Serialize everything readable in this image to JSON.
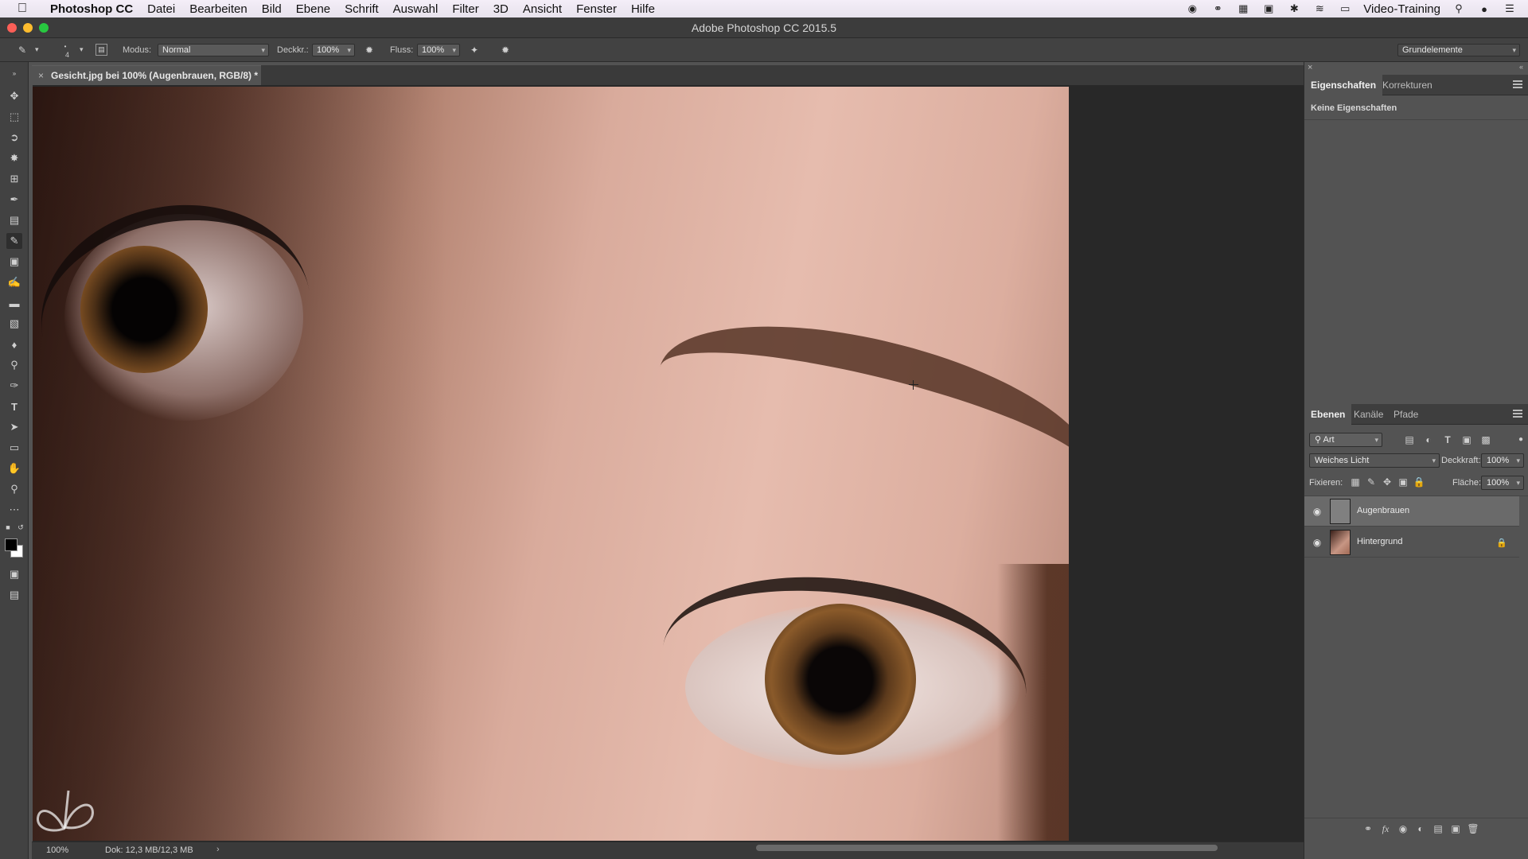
{
  "menubar": {
    "app_name": "Photoshop CC",
    "items": [
      "Datei",
      "Bearbeiten",
      "Bild",
      "Ebene",
      "Schrift",
      "Auswahl",
      "Filter",
      "3D",
      "Ansicht",
      "Fenster",
      "Hilfe"
    ],
    "right_label": "Video-Training"
  },
  "window": {
    "title": "Adobe Photoshop CC 2015.5"
  },
  "options": {
    "brush_size": "4",
    "mode_label": "Modus:",
    "mode_value": "Normal",
    "opacity_label": "Deckkr.:",
    "opacity_value": "100%",
    "flow_label": "Fluss:",
    "flow_value": "100%",
    "workspace": "Grundelemente"
  },
  "document": {
    "tab_title": "Gesicht.jpg bei 100% (Augenbrauen, RGB/8) *"
  },
  "status": {
    "zoom": "100%",
    "doc_size": "Dok: 12,3 MB/12,3 MB"
  },
  "properties_panel": {
    "tabs": [
      "Eigenschaften",
      "Korrekturen"
    ],
    "active_tab": "Eigenschaften",
    "message": "Keine Eigenschaften"
  },
  "layers_panel": {
    "tabs": [
      "Ebenen",
      "Kanäle",
      "Pfade"
    ],
    "active_tab": "Ebenen",
    "filter_value": "Art",
    "blend_mode": "Weiches Licht",
    "opacity_label": "Deckkraft:",
    "opacity_value": "100%",
    "lock_label": "Fixieren:",
    "fill_label": "Fläche:",
    "fill_value": "100%",
    "layers": [
      {
        "name": "Augenbrauen",
        "visible": true,
        "selected": true,
        "locked": false
      },
      {
        "name": "Hintergrund",
        "visible": true,
        "selected": false,
        "locked": true
      }
    ]
  },
  "colors": {
    "panel_bg": "#535353",
    "dark_bg": "#3a3a3a",
    "selected_layer": "#6a6a6a"
  }
}
